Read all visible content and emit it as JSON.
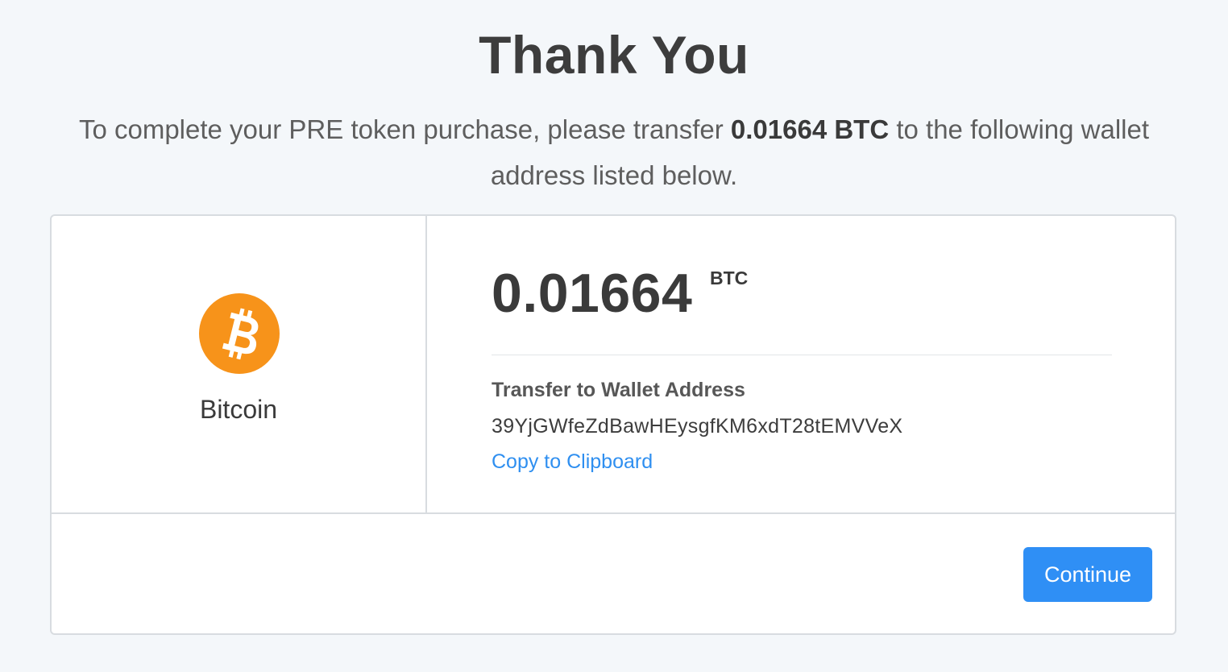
{
  "header": {
    "title": "Thank You",
    "message_prefix": "To complete your PRE token purchase, please transfer ",
    "message_amount": "0.01664 BTC",
    "message_suffix": " to the following wallet address listed below."
  },
  "currency": {
    "icon": "bitcoin-icon",
    "name": "Bitcoin",
    "brand_color": "#f7931a"
  },
  "payment": {
    "amount": "0.01664",
    "unit": "BTC",
    "wallet_label": "Transfer to Wallet Address",
    "wallet_address": "39YjGWfeZdBawHEysgfKM6xdT28tEMVVeX",
    "copy_label": "Copy to Clipboard"
  },
  "footer": {
    "continue_label": "Continue",
    "button_color": "#2f8ff5"
  }
}
